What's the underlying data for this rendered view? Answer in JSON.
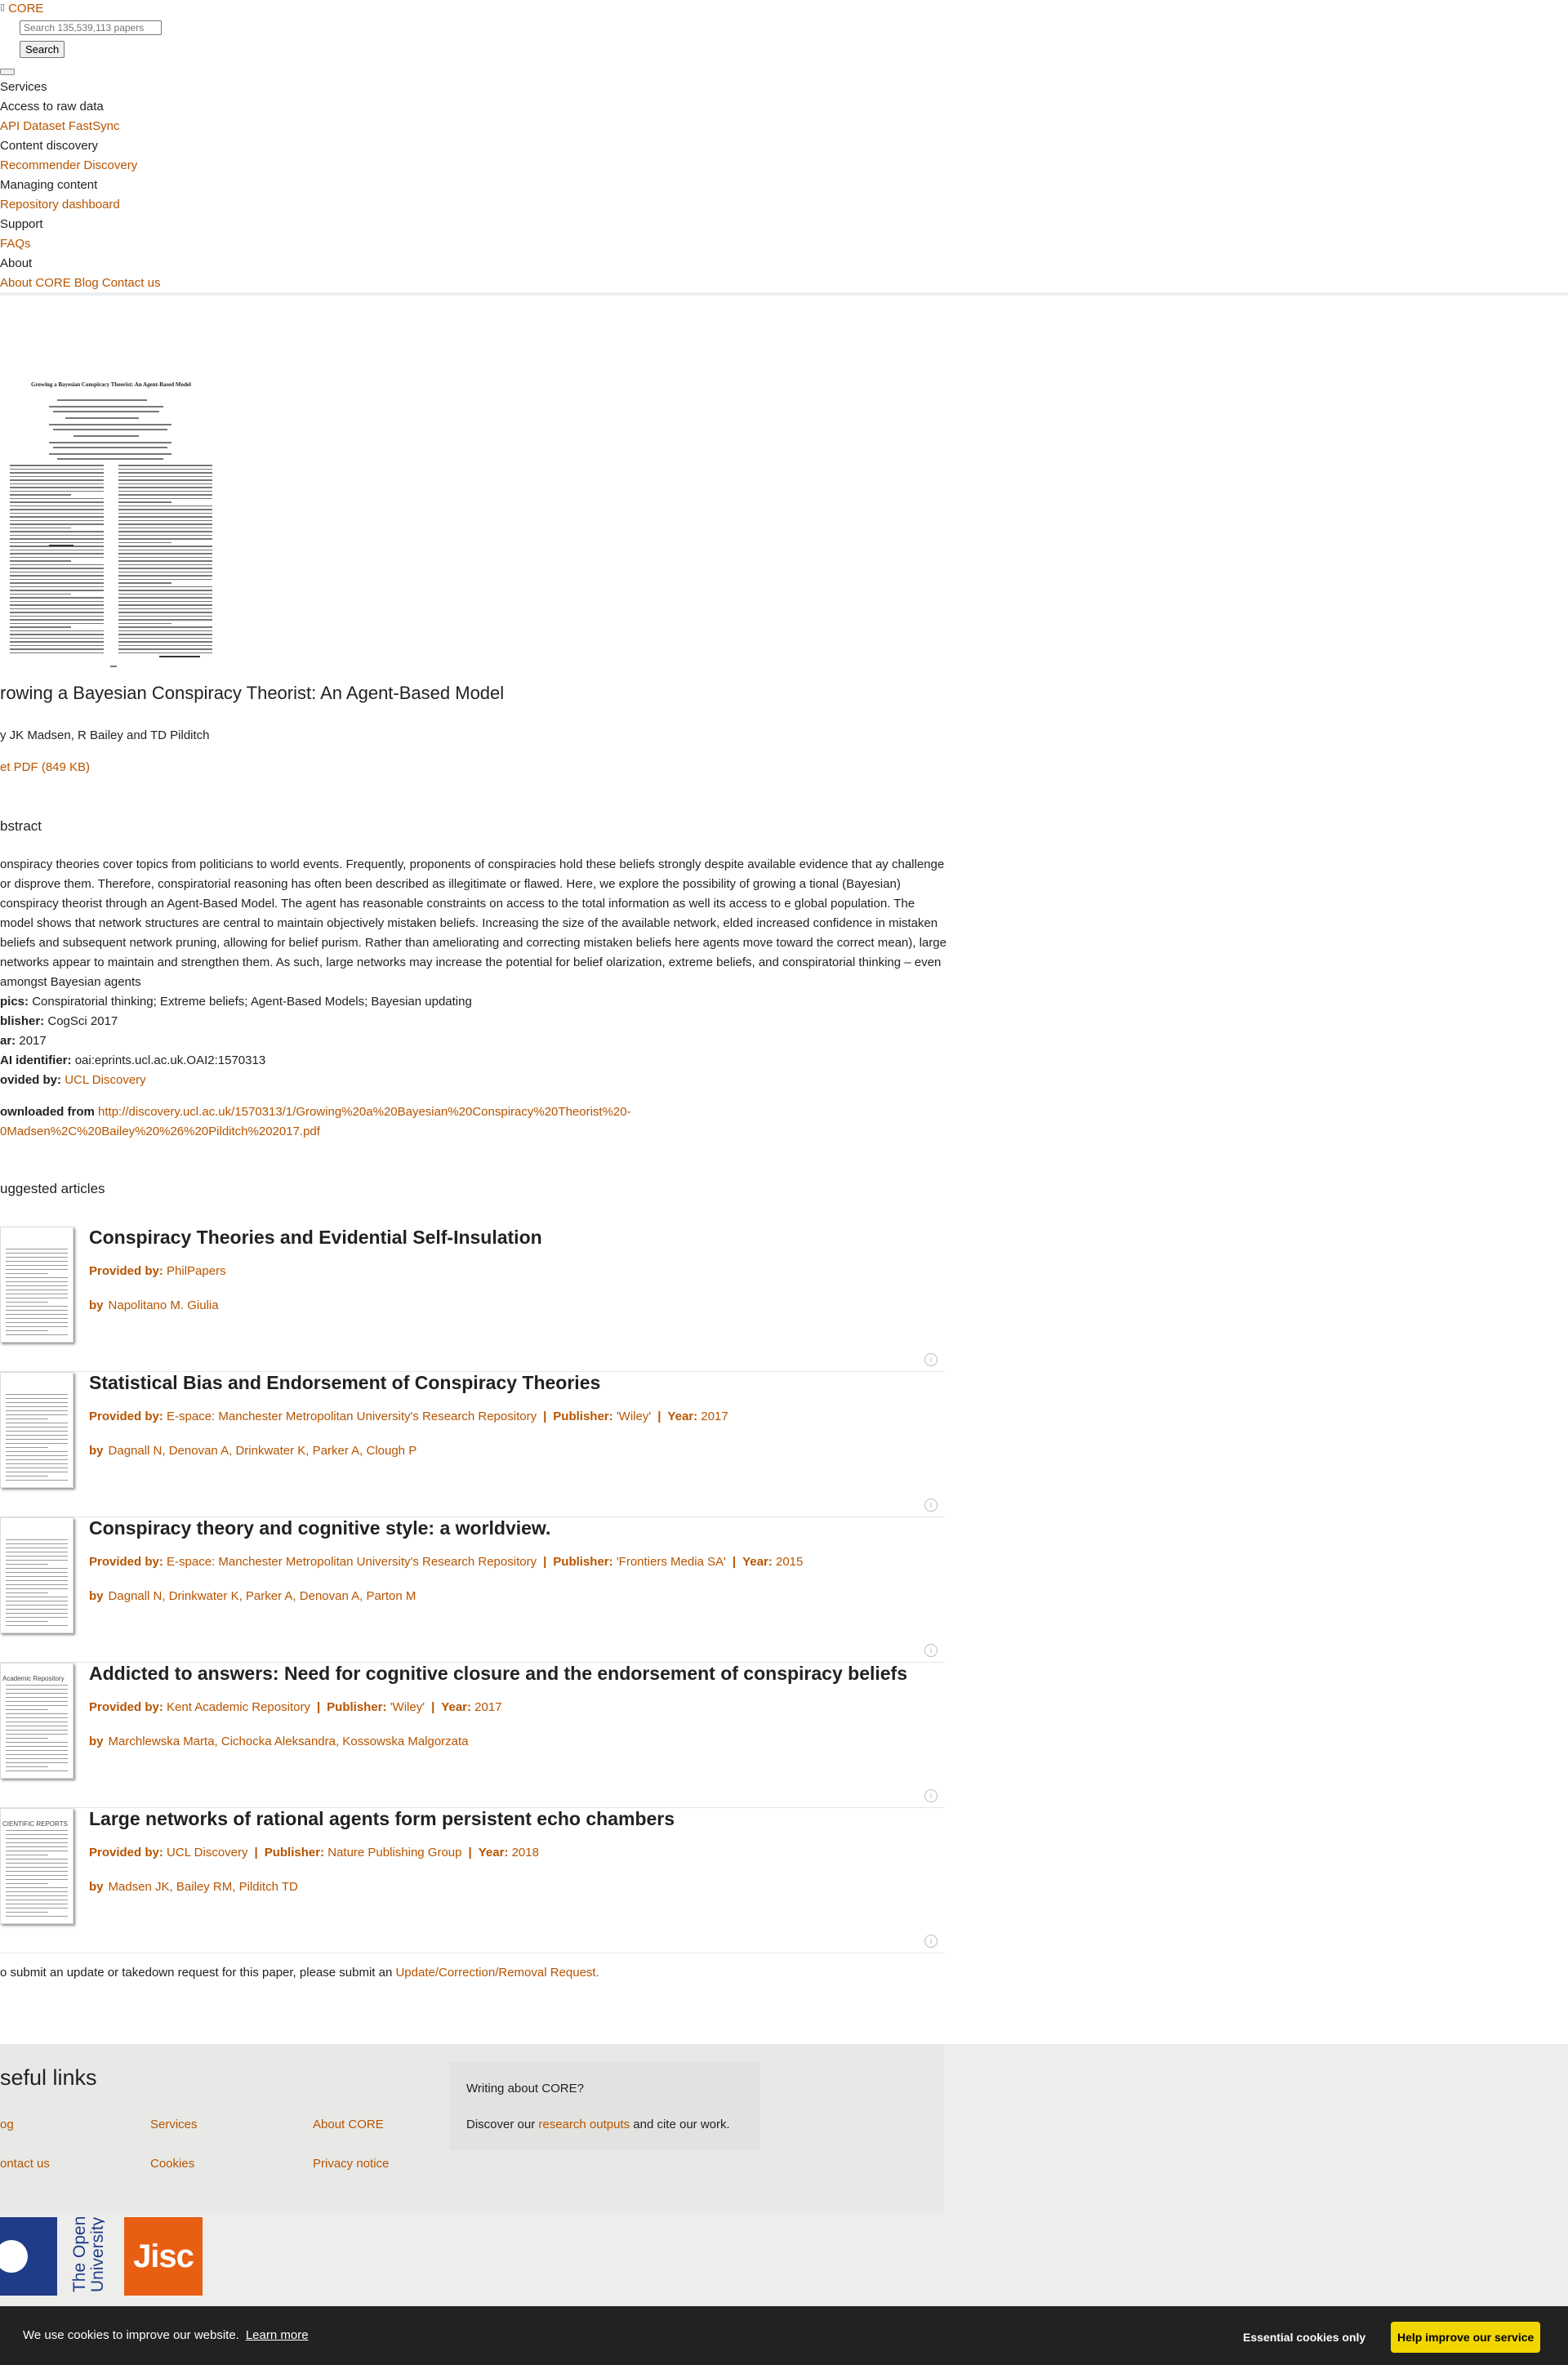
{
  "header": {
    "logo": "CORE",
    "search_placeholder": "Search 135,539,113 papers",
    "search_button": "Search"
  },
  "nav": {
    "services": "Services",
    "raw_data": "Access to raw data",
    "raw_links": [
      "API",
      "Dataset",
      "FastSync"
    ],
    "content_discovery": "Content discovery",
    "discovery_links": [
      "Recommender",
      "Discovery"
    ],
    "managing_content": "Managing content",
    "managing_links": [
      "Repository dashboard"
    ],
    "support": "Support",
    "support_links": [
      "FAQs"
    ],
    "about": "About",
    "about_links": [
      "About CORE",
      "Blog",
      "Contact us"
    ]
  },
  "paper": {
    "title": "rowing a Bayesian Conspiracy Theorist: An Agent-Based Model",
    "authors": "y JK Madsen, R Bailey and TD Pilditch",
    "pdf": "et PDF (849 KB)",
    "abstract_heading": "bstract",
    "abstract": "onspiracy theories cover topics from politicians to world events. Frequently, proponents of conspiracies hold these beliefs strongly despite available evidence that ay challenge or disprove them. Therefore, conspiratorial reasoning has often been described as illegitimate or flawed. Here, we explore the possibility of growing a tional (Bayesian) conspiracy theorist through an Agent-Based Model. The agent has reasonable constraints on access to the total information as well its access to e global population. The model shows that network structures are central to maintain objectively mistaken beliefs. Increasing the size of the available network, elded increased confidence in mistaken beliefs and subsequent network pruning, allowing for belief purism. Rather than ameliorating and correcting mistaken beliefs here agents move toward the correct mean), large networks appear to maintain and strengthen them. As such, large networks may increase the potential for belief olarization, extreme beliefs, and conspiratorial thinking – even amongst Bayesian agents",
    "topics_label": "pics:",
    "topics": "Conspiratorial thinking; Extreme beliefs; Agent-Based Models; Bayesian updating",
    "publisher_label": "blisher:",
    "publisher": "CogSci 2017",
    "year_label": "ar:",
    "year": "2017",
    "oai_label": "AI identifier:",
    "oai": "oai:eprints.ucl.ac.uk.OAI2:1570313",
    "provided_label": "ovided by:",
    "provided": "UCL Discovery",
    "downloaded_label": "ownloaded from",
    "downloaded_url_1": "http://discovery.ucl.ac.uk/1570313/1/Growing%20a%20Bayesian%20Conspiracy%20Theorist%20-",
    "downloaded_url_2": "0Madsen%2C%20Bailey%20%26%20Pilditch%202017.pdf"
  },
  "thumbnail": {
    "title": "Growing a Bayesian Conspiracy Theorist: An Agent-Based Model"
  },
  "suggested": {
    "heading": "uggested articles",
    "items": [
      {
        "title": "Conspiracy Theories and Evidential Self-Insulation",
        "provided_label": "Provided by:",
        "provided": "PhilPapers",
        "by_label": "by",
        "authors": "Napolitano M. Giulia"
      },
      {
        "title": "Statistical Bias and Endorsement of Conspiracy Theories",
        "provided_label": "Provided by:",
        "provided": "E-space: Manchester Metropolitan University's Research Repository",
        "publisher_label": "Publisher:",
        "publisher": "'Wiley'",
        "year_label": "Year:",
        "year": "2017",
        "by_label": "by",
        "authors": "Dagnall N, Denovan A, Drinkwater K, Parker A, Clough P"
      },
      {
        "title": "Conspiracy theory and cognitive style: a worldview.",
        "provided_label": "Provided by:",
        "provided": "E-space: Manchester Metropolitan University's Research Repository",
        "publisher_label": "Publisher:",
        "publisher": "'Frontiers Media SA'",
        "year_label": "Year:",
        "year": "2015",
        "by_label": "by",
        "authors": "Dagnall N, Drinkwater K, Parker A, Denovan A, Parton M"
      },
      {
        "title": "Addicted to answers: Need for cognitive closure and the endorsement of conspiracy beliefs",
        "provided_label": "Provided by:",
        "provided": "Kent Academic Repository",
        "publisher_label": "Publisher:",
        "publisher": "'Wiley'",
        "year_label": "Year:",
        "year": "2017",
        "by_label": "by",
        "authors": "Marchlewska Marta, Cichocka Aleksandra, Kossowska Malgorzata"
      },
      {
        "title": "Large networks of rational agents form persistent echo chambers",
        "provided_label": "Provided by:",
        "provided": "UCL Discovery",
        "publisher_label": "Publisher:",
        "publisher": "Nature Publishing Group",
        "year_label": "Year:",
        "year": "2018",
        "by_label": "by",
        "authors": "Madsen JK, Bailey RM, Pilditch TD"
      }
    ],
    "thumb_labels": [
      "",
      "",
      "",
      "Academic Repository",
      "CIENTIFIC REPORTS"
    ]
  },
  "takedown": {
    "prefix": "o submit an update or takedown request for this paper, please submit an",
    "link": "Update/Correction/Removal Request."
  },
  "footer": {
    "heading": "seful links",
    "links": [
      "og",
      "Services",
      "About CORE",
      "ontact us",
      "Cookies",
      "Privacy notice"
    ],
    "writing_title": "Writing about CORE?",
    "writing_prefix": "Discover our",
    "writing_link": "research outputs",
    "writing_suffix": "and cite our work.",
    "ou_logo_text": "The Open University",
    "jisc_logo_text": "Jisc"
  },
  "cookie": {
    "text": "We use cookies to improve our website.",
    "learn_more": "Learn more",
    "essential": "Essential cookies only",
    "help": "Help improve our service"
  },
  "colors": {
    "link": "#b75400",
    "jisc": "#e85e13",
    "ou_blue": "#1f3c89",
    "cookie_bar": "#222222",
    "cookie_button": "#f1d600"
  }
}
